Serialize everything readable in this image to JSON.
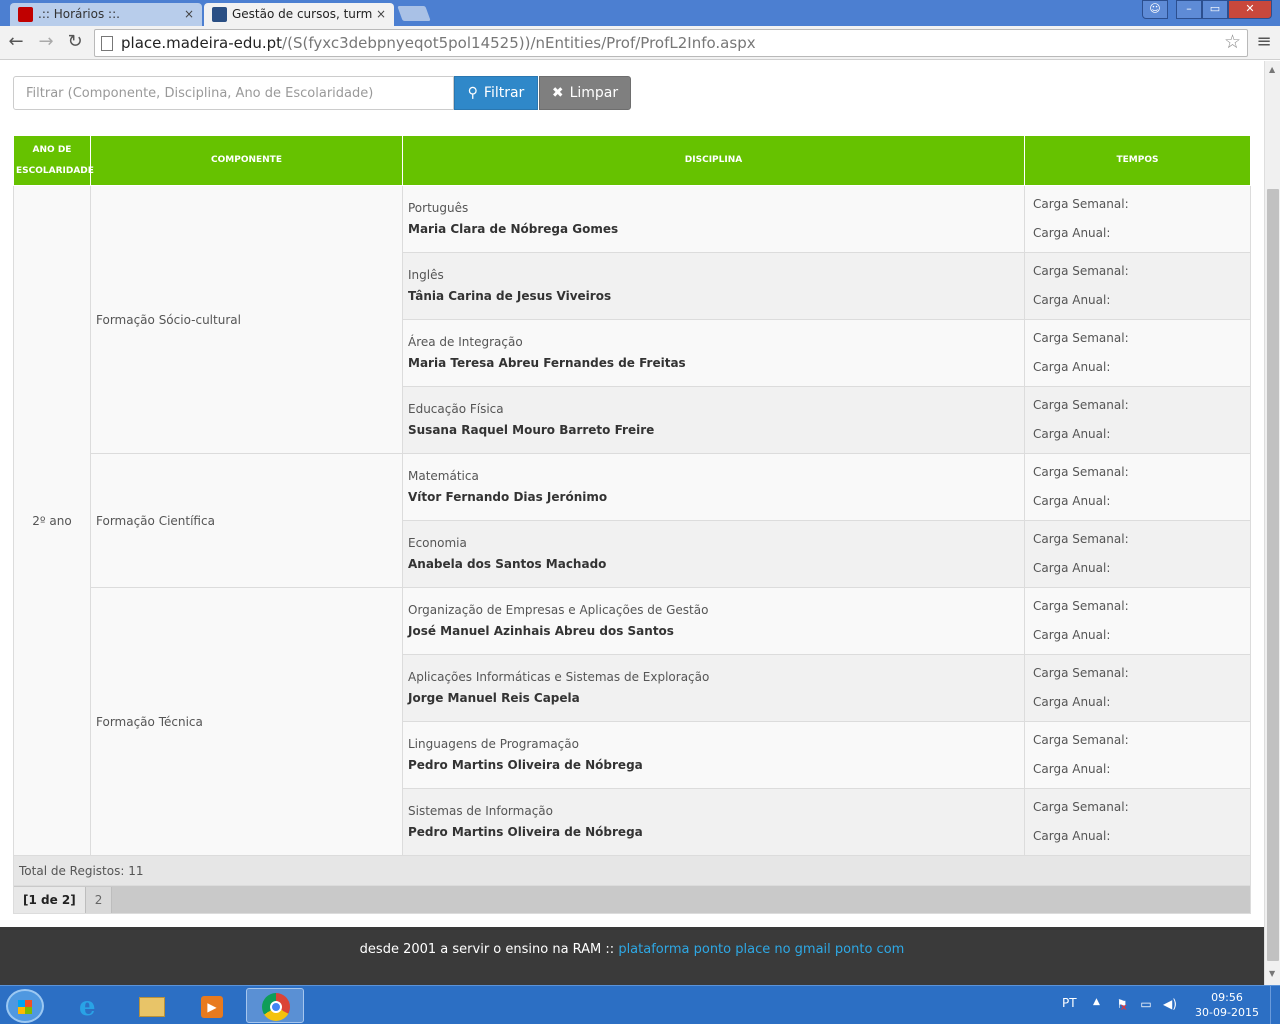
{
  "browser": {
    "tabs": [
      {
        "label": ".:: Horários ::.",
        "close": "×"
      },
      {
        "label": "Gestão de cursos, turmas,",
        "close": "×"
      }
    ],
    "url_host": "place.madeira-edu.pt",
    "url_path": "/(S(fyxc3debpnyeqot5pol14525))/nEntities/Prof/ProfL2Info.aspx",
    "star": "☆",
    "menu": "≡",
    "nav": {
      "back": "←",
      "forward": "→",
      "reload": "↻"
    },
    "window_controls": {
      "user": "☺",
      "minimize": "–",
      "maximize": "▭",
      "close": "✕"
    }
  },
  "filter": {
    "placeholder": "Filtrar (Componente, Disciplina, Ano de Escolaridade)",
    "filter_icon": "⚲",
    "filter_label": "Filtrar",
    "clear_icon": "✖",
    "clear_label": "Limpar"
  },
  "table": {
    "headers": {
      "ano_line1": "Ano de",
      "ano_line2": "Escolaridade",
      "componente": "Componente",
      "disciplina": "Disciplina",
      "tempos": "Tempos"
    },
    "ano": "2º ano",
    "componentes": [
      "Formação Sócio-cultural",
      "Formação Científica",
      "Formação Técnica"
    ],
    "rows": [
      {
        "disciplina": "Português",
        "professor": "Maria Clara de Nóbrega Gomes",
        "carga_semanal": "Carga Semanal:",
        "carga_anual": "Carga Anual:"
      },
      {
        "disciplina": "Inglês",
        "professor": "Tânia Carina de Jesus Viveiros",
        "carga_semanal": "Carga Semanal:",
        "carga_anual": "Carga Anual:"
      },
      {
        "disciplina": "Área de Integração",
        "professor": "Maria Teresa Abreu Fernandes de Freitas",
        "carga_semanal": "Carga Semanal:",
        "carga_anual": "Carga Anual:"
      },
      {
        "disciplina": "Educação Física",
        "professor": "Susana Raquel Mouro Barreto Freire",
        "carga_semanal": "Carga Semanal:",
        "carga_anual": "Carga Anual:"
      },
      {
        "disciplina": "Matemática",
        "professor": "Vítor Fernando Dias Jerónimo",
        "carga_semanal": "Carga Semanal:",
        "carga_anual": "Carga Anual:"
      },
      {
        "disciplina": "Economia",
        "professor": "Anabela dos Santos Machado",
        "carga_semanal": "Carga Semanal:",
        "carga_anual": "Carga Anual:"
      },
      {
        "disciplina": "Organização de Empresas e Aplicações de Gestão",
        "professor": "José Manuel Azinhais Abreu dos Santos",
        "carga_semanal": "Carga Semanal:",
        "carga_anual": "Carga Anual:"
      },
      {
        "disciplina": "Aplicações Informáticas e Sistemas de Exploração",
        "professor": "Jorge Manuel Reis Capela",
        "carga_semanal": "Carga Semanal:",
        "carga_anual": "Carga Anual:"
      },
      {
        "disciplina": "Linguagens de Programação",
        "professor": "Pedro Martins Oliveira de Nóbrega",
        "carga_semanal": "Carga Semanal:",
        "carga_anual": "Carga Anual:"
      },
      {
        "disciplina": "Sistemas de Informação",
        "professor": "Pedro Martins Oliveira de Nóbrega",
        "carga_semanal": "Carga Semanal:",
        "carga_anual": "Carga Anual:"
      }
    ],
    "total": "Total de Registos: 11",
    "pager": {
      "current": "[1 de 2]",
      "next": "2"
    }
  },
  "footer": {
    "text": "desde 2001 a servir o ensino na RAM :: ",
    "link": "plataforma ponto place no gmail ponto com"
  },
  "taskbar": {
    "language": "PT",
    "tray_arrow": "▲",
    "flag": "⚑",
    "flag_x": "×",
    "network": "▭",
    "volume": "◀)",
    "time": "09:56",
    "date": "30-09-2015",
    "ie_glyph": "e",
    "media_glyph": "▶"
  },
  "colors": {
    "header_green": "#66c200",
    "filter_blue": "#2f88c9",
    "clear_gray": "#7f7f7f",
    "footer_dark": "#3a3a3a",
    "footer_link": "#2ea8e5",
    "taskbar_blue": "#2c6fc4"
  }
}
